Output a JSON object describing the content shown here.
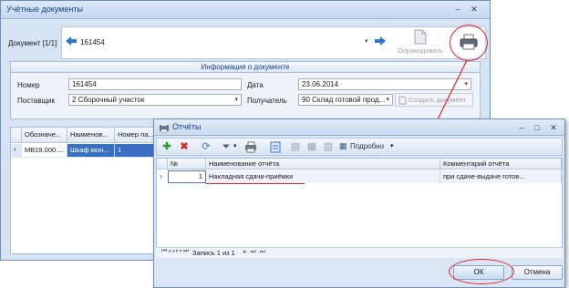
{
  "main_window": {
    "title": "Учётные документы",
    "document_label": "Документ [1/1]",
    "document_value": "161454",
    "post_label": "Оприходовать",
    "info_header": "Информация о документе",
    "number_label": "Номер",
    "number_value": "161454",
    "date_label": "Дата",
    "date_value": "23.06.2014",
    "supplier_label": "Поставщик",
    "supplier_value": "2 Сборочный участок",
    "receiver_label": "Получатель",
    "receiver_value": "90 Склад готовой прод...",
    "create_doc_label": "Создать документ",
    "grid": {
      "columns": [
        "Обозначе...",
        "Наименов...",
        "Номер па..."
      ],
      "rows": [
        [
          "МВ19.000....",
          "Шкаф мон...",
          "1"
        ]
      ]
    }
  },
  "dialog": {
    "title": "Отчёты",
    "detail_label": "Подробно",
    "columns": [
      "№",
      "Наименование отчёта",
      "Комментарий отчёта"
    ],
    "rows": [
      {
        "num": "1",
        "name": "Накладная сдачи-приёмки",
        "comment": "при сдаче-выдаче готов..."
      }
    ],
    "nav_text": "Запись 1 из 1",
    "ok_label": "ОК",
    "cancel_label": "Отмена"
  },
  "colors": {
    "title_text": "#15428b",
    "annotation_red": "#e0252b",
    "selection_blue": "#3b6fc4"
  }
}
